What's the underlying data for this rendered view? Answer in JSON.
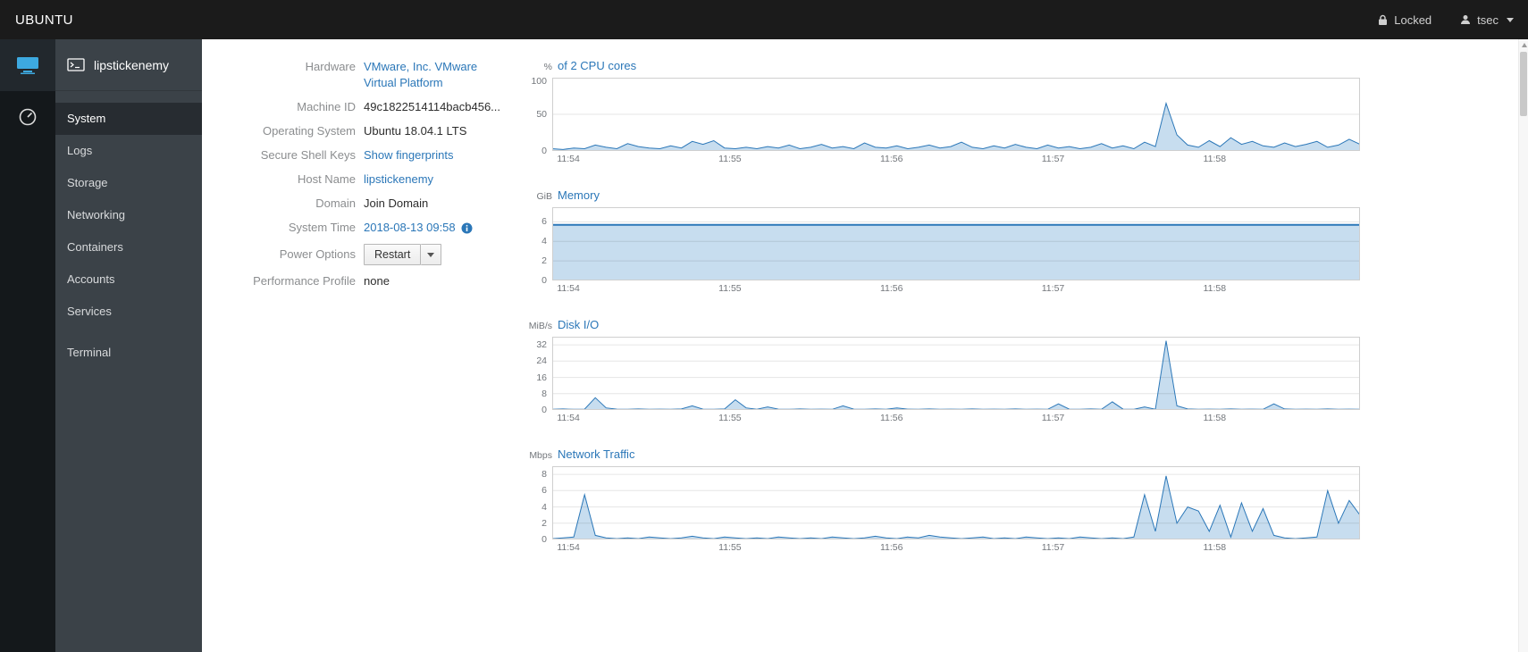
{
  "masthead": {
    "brand": "UBUNTU",
    "locked_label": "Locked",
    "user": "tsec"
  },
  "sidebar": {
    "hostname": "lipstickenemy",
    "items": [
      {
        "label": "System",
        "active": true
      },
      {
        "label": "Logs",
        "active": false
      },
      {
        "label": "Storage",
        "active": false
      },
      {
        "label": "Networking",
        "active": false
      },
      {
        "label": "Containers",
        "active": false
      },
      {
        "label": "Accounts",
        "active": false
      },
      {
        "label": "Services",
        "active": false
      }
    ],
    "tools": [
      {
        "label": "Terminal",
        "active": false
      }
    ]
  },
  "system_info": {
    "hardware_label": "Hardware",
    "hardware_value": "VMware, Inc. VMware Virtual Platform",
    "machine_id_label": "Machine ID",
    "machine_id_value": "49c1822514114bacb456...",
    "os_label": "Operating System",
    "os_value": "Ubuntu 18.04.1 LTS",
    "ssh_label": "Secure Shell Keys",
    "ssh_value": "Show fingerprints",
    "hostname_label": "Host Name",
    "hostname_value": "lipstickenemy",
    "domain_label": "Domain",
    "domain_value": "Join Domain",
    "time_label": "System Time",
    "time_value": "2018-08-13 09:58",
    "power_label": "Power Options",
    "power_value": "Restart",
    "profile_label": "Performance Profile",
    "profile_value": "none"
  },
  "colors": {
    "accent": "#2b77b8",
    "chart_line": "#2b77b8",
    "chart_fill": "#c7ddef",
    "grid": "#dcdcdc",
    "plot_border": "#cfcfcf"
  },
  "chart_data": [
    {
      "type": "area",
      "unit": "%",
      "title": "of 2 CPU cores",
      "ylim": [
        0,
        100
      ],
      "yticks": [
        0,
        50,
        100
      ],
      "xlim": [
        0,
        300
      ],
      "xticks": [
        {
          "x": 6,
          "label": "11:54"
        },
        {
          "x": 66,
          "label": "11:55"
        },
        {
          "x": 126,
          "label": "11:56"
        },
        {
          "x": 186,
          "label": "11:57"
        },
        {
          "x": 246,
          "label": "11:58"
        }
      ],
      "x_start": 0,
      "x_step": 4,
      "line_width": 1,
      "values": [
        3,
        2,
        4,
        3,
        8,
        5,
        3,
        10,
        6,
        4,
        3,
        7,
        4,
        13,
        9,
        14,
        4,
        3,
        5,
        3,
        6,
        4,
        8,
        3,
        5,
        9,
        4,
        6,
        3,
        11,
        5,
        4,
        7,
        3,
        5,
        8,
        4,
        6,
        12,
        5,
        3,
        7,
        4,
        9,
        5,
        3,
        8,
        4,
        6,
        3,
        5,
        10,
        4,
        7,
        3,
        12,
        6,
        65,
        22,
        8,
        5,
        14,
        6,
        18,
        9,
        13,
        7,
        5,
        11,
        6,
        9,
        13,
        5,
        8,
        16,
        9
      ]
    },
    {
      "type": "area",
      "unit": "GiB",
      "title": "Memory",
      "ylim": [
        0,
        7.5
      ],
      "yticks": [
        0,
        2,
        4,
        6
      ],
      "xlim": [
        0,
        300
      ],
      "xticks": [
        {
          "x": 6,
          "label": "11:54"
        },
        {
          "x": 66,
          "label": "11:55"
        },
        {
          "x": 126,
          "label": "11:56"
        },
        {
          "x": 186,
          "label": "11:57"
        },
        {
          "x": 246,
          "label": "11:58"
        }
      ],
      "x_start": 0,
      "x_step": 300,
      "line_width": 2,
      "values": [
        5.7,
        5.7
      ]
    },
    {
      "type": "area",
      "unit": "MiB/s",
      "title": "Disk I/O",
      "ylim": [
        0,
        36
      ],
      "yticks": [
        0,
        8,
        16,
        24,
        32
      ],
      "xlim": [
        0,
        300
      ],
      "xticks": [
        {
          "x": 6,
          "label": "11:54"
        },
        {
          "x": 66,
          "label": "11:55"
        },
        {
          "x": 126,
          "label": "11:56"
        },
        {
          "x": 186,
          "label": "11:57"
        },
        {
          "x": 246,
          "label": "11:58"
        }
      ],
      "x_start": 0,
      "x_step": 4,
      "line_width": 1,
      "values": [
        0.3,
        0.5,
        0.3,
        0.4,
        6,
        1,
        0.4,
        0.3,
        0.5,
        0.3,
        0.4,
        0.3,
        0.5,
        2,
        0.4,
        0.3,
        0.5,
        5,
        1,
        0.3,
        1.5,
        0.4,
        0.3,
        0.5,
        0.3,
        0.4,
        0.3,
        2,
        0.4,
        0.3,
        0.5,
        0.3,
        1,
        0.4,
        0.3,
        0.5,
        0.3,
        0.4,
        0.3,
        0.5,
        0.3,
        0.4,
        0.3,
        0.5,
        0.3,
        0.4,
        0.3,
        3,
        0.4,
        0.3,
        0.5,
        0.3,
        4,
        0.4,
        0.3,
        1.5,
        0.3,
        34,
        2,
        0.5,
        0.3,
        0.4,
        0.3,
        0.5,
        0.3,
        0.4,
        0.3,
        3,
        0.5,
        0.3,
        0.4,
        0.3,
        0.5,
        0.3,
        0.4,
        0.3
      ]
    },
    {
      "type": "area",
      "unit": "Mbps",
      "title": "Network Traffic",
      "ylim": [
        0,
        9
      ],
      "yticks": [
        0,
        2,
        4,
        6,
        8
      ],
      "xlim": [
        0,
        300
      ],
      "xticks": [
        {
          "x": 6,
          "label": "11:54"
        },
        {
          "x": 66,
          "label": "11:55"
        },
        {
          "x": 126,
          "label": "11:56"
        },
        {
          "x": 186,
          "label": "11:57"
        },
        {
          "x": 246,
          "label": "11:58"
        }
      ],
      "x_start": 0,
      "x_step": 4,
      "line_width": 1,
      "values": [
        0.1,
        0.2,
        0.3,
        5.5,
        0.5,
        0.2,
        0.1,
        0.2,
        0.1,
        0.3,
        0.2,
        0.1,
        0.2,
        0.4,
        0.2,
        0.1,
        0.3,
        0.2,
        0.1,
        0.2,
        0.1,
        0.3,
        0.2,
        0.1,
        0.2,
        0.1,
        0.3,
        0.2,
        0.1,
        0.2,
        0.4,
        0.2,
        0.1,
        0.3,
        0.2,
        0.5,
        0.3,
        0.2,
        0.1,
        0.2,
        0.3,
        0.1,
        0.2,
        0.1,
        0.3,
        0.2,
        0.1,
        0.2,
        0.1,
        0.3,
        0.2,
        0.1,
        0.2,
        0.1,
        0.3,
        5.5,
        1,
        7.8,
        2,
        4,
        3.5,
        1,
        4.2,
        0.3,
        4.5,
        1,
        3.8,
        0.5,
        0.2,
        0.1,
        0.2,
        0.3,
        6,
        2,
        4.8,
        3
      ]
    }
  ]
}
